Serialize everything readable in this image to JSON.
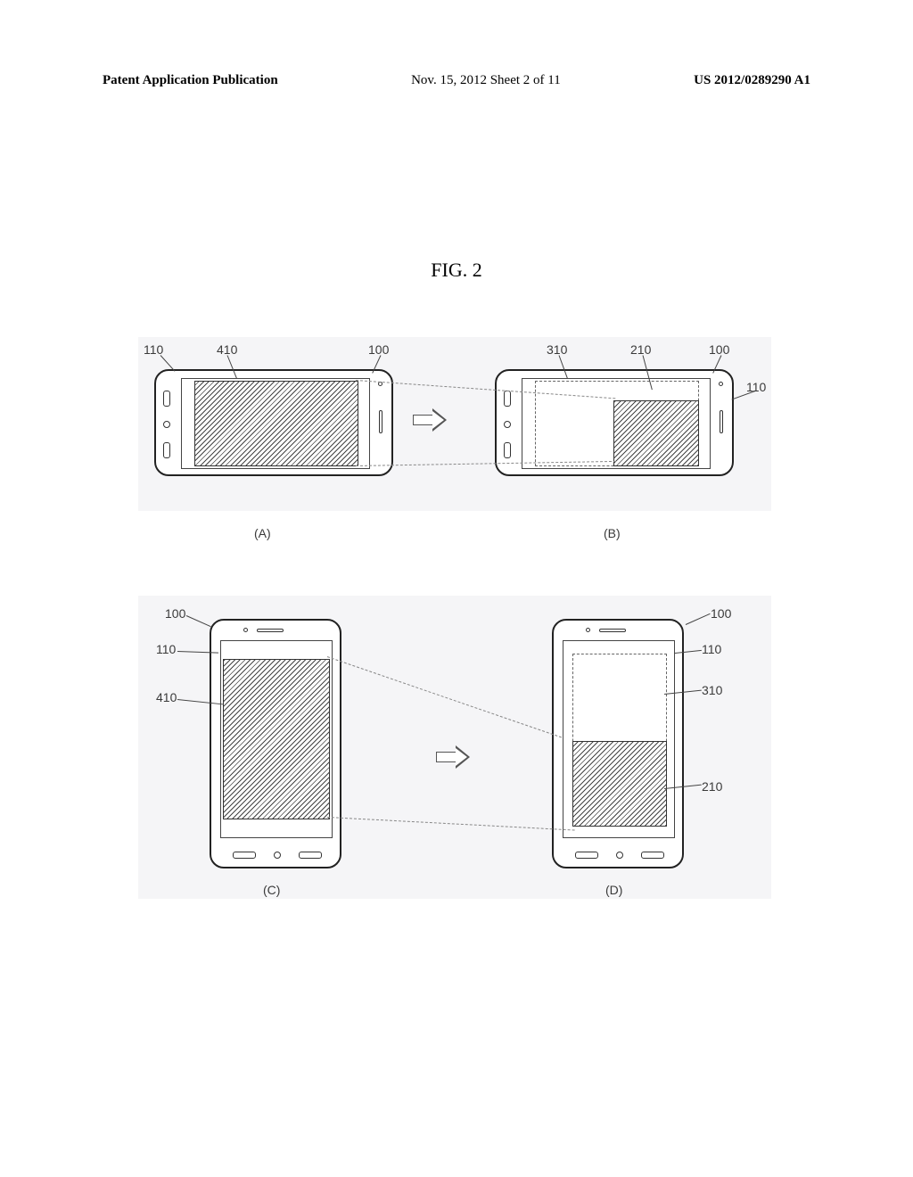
{
  "header": {
    "left": "Patent Application Publication",
    "center": "Nov. 15, 2012  Sheet 2 of 11",
    "right": "US 2012/0289290 A1"
  },
  "figure": {
    "title": "FIG. 2",
    "sublabels": {
      "a": "(A)",
      "b": "(B)",
      "c": "(C)",
      "d": "(D)"
    },
    "reference_numerals": {
      "body": "100",
      "display": "110",
      "dashed_region": "310",
      "reduced_image": "210",
      "full_image": "410"
    }
  }
}
